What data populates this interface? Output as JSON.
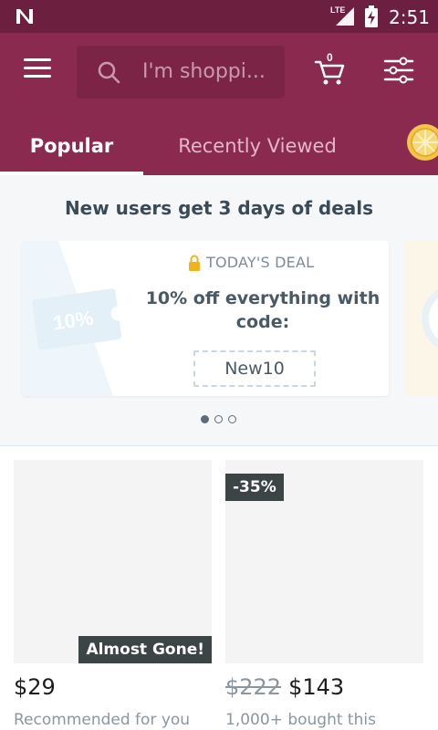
{
  "status_bar": {
    "network": "LTE",
    "time": "2:51",
    "icons": [
      "notification-n-icon",
      "signal-icon",
      "battery-charging-icon"
    ]
  },
  "header": {
    "search_placeholder": "I'm shoppi...",
    "cart_count": "0",
    "icons": [
      "menu-icon",
      "search-icon",
      "cart-icon",
      "filter-icon",
      "coin-icon"
    ]
  },
  "tabs": [
    {
      "label": "Popular",
      "active": true
    },
    {
      "label": "Recently Viewed",
      "active": false
    }
  ],
  "promo": {
    "title": "New users get 3 days of deals",
    "deal_label": "TODAY'S DEAL",
    "deal_text": "10% off everything with code:",
    "code": "New10",
    "art_text": "10%",
    "carousel_index": 0,
    "carousel_count": 3
  },
  "products": [
    {
      "price": "$29",
      "old_price": "",
      "subtitle": "Recommended for you",
      "badge": "Almost Gone!"
    },
    {
      "price": "$143",
      "old_price": "$222",
      "subtitle": "1,000+ bought this",
      "badge": "-35%"
    }
  ],
  "colors": {
    "status_bar": "#6d1f3f",
    "app_bar": "#8a2a4e",
    "search_bg": "#7b2446",
    "badge": "#3d4446",
    "lock": "#f2b21b"
  }
}
